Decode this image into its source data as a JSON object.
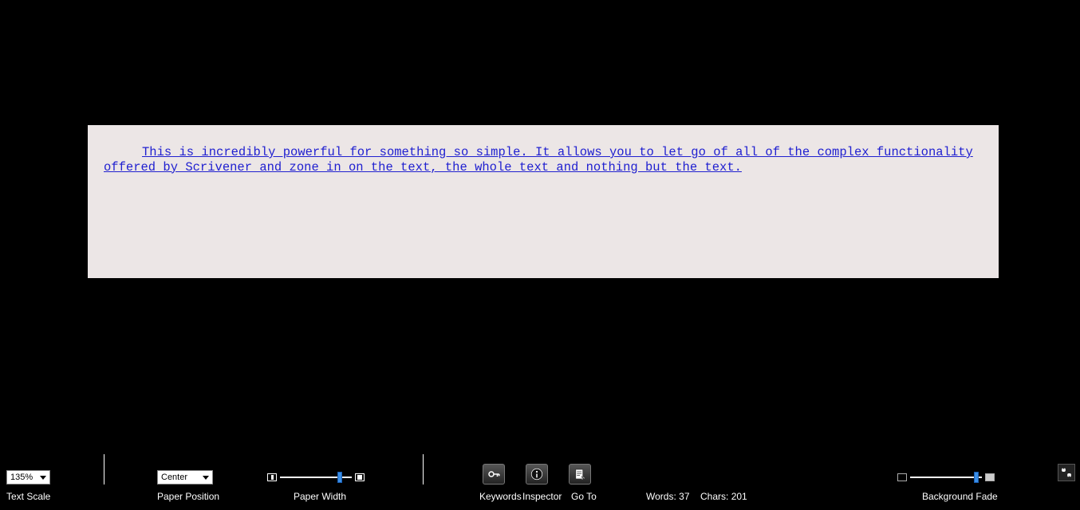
{
  "document": {
    "text": "This is incredibly powerful for something so simple. It allows you to let go of all of the complex functionality offered by Scrivener and zone in on the text, the whole text and nothing but the text. "
  },
  "controls": {
    "text_scale": {
      "value": "135%",
      "label": "Text Scale"
    },
    "paper_position": {
      "value": "Center",
      "label": "Paper Position"
    },
    "paper_width": {
      "label": "Paper Width"
    },
    "keywords_label": "Keywords",
    "inspector_label": "Inspector",
    "goto_label": "Go To",
    "background_fade_label": "Background Fade"
  },
  "stats": {
    "words_label": "Words:",
    "words_value": "37",
    "chars_label": "Chars:",
    "chars_value": "201"
  }
}
